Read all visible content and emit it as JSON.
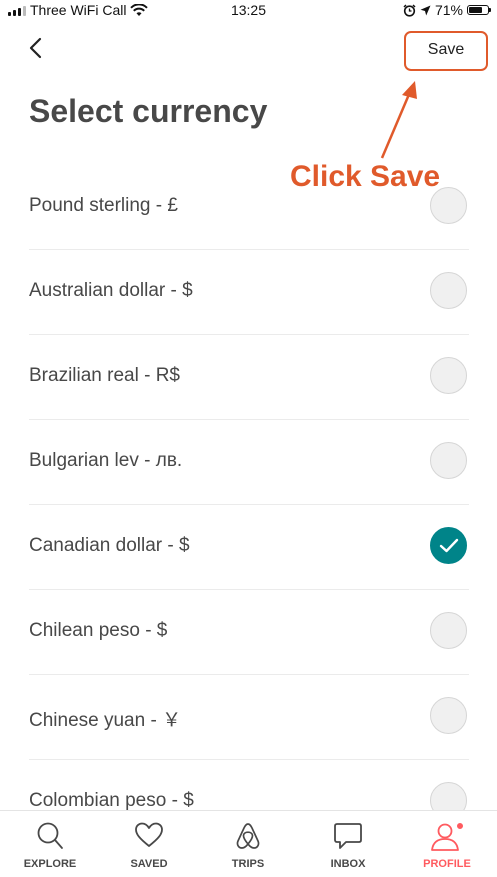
{
  "status_bar": {
    "carrier": "Three WiFi Call",
    "time": "13:25",
    "battery": "71%"
  },
  "header": {
    "save_label": "Save",
    "title": "Select currency"
  },
  "annotation": {
    "text": "Click Save",
    "color": "#e05a2b"
  },
  "currencies": [
    {
      "label": "Pound sterling - £",
      "selected": false
    },
    {
      "label": "Australian dollar - $",
      "selected": false
    },
    {
      "label": "Brazilian real - R$",
      "selected": false
    },
    {
      "label": "Bulgarian lev - лв.",
      "selected": false
    },
    {
      "label": "Canadian dollar - $",
      "selected": true
    },
    {
      "label": "Chilean peso - $",
      "selected": false
    },
    {
      "label": "Chinese yuan - ￥",
      "selected": false
    },
    {
      "label": "Colombian peso - $",
      "selected": false
    }
  ],
  "tabs": [
    {
      "label": "EXPLORE",
      "icon": "search-icon",
      "active": false
    },
    {
      "label": "SAVED",
      "icon": "heart-icon",
      "active": false
    },
    {
      "label": "TRIPS",
      "icon": "airbnb-logo-icon",
      "active": false
    },
    {
      "label": "INBOX",
      "icon": "message-icon",
      "active": false
    },
    {
      "label": "PROFILE",
      "icon": "profile-icon",
      "active": true
    }
  ],
  "colors": {
    "accent_teal": "#008489",
    "active_tab": "#ff5a5f",
    "annotation": "#e05a2b"
  }
}
